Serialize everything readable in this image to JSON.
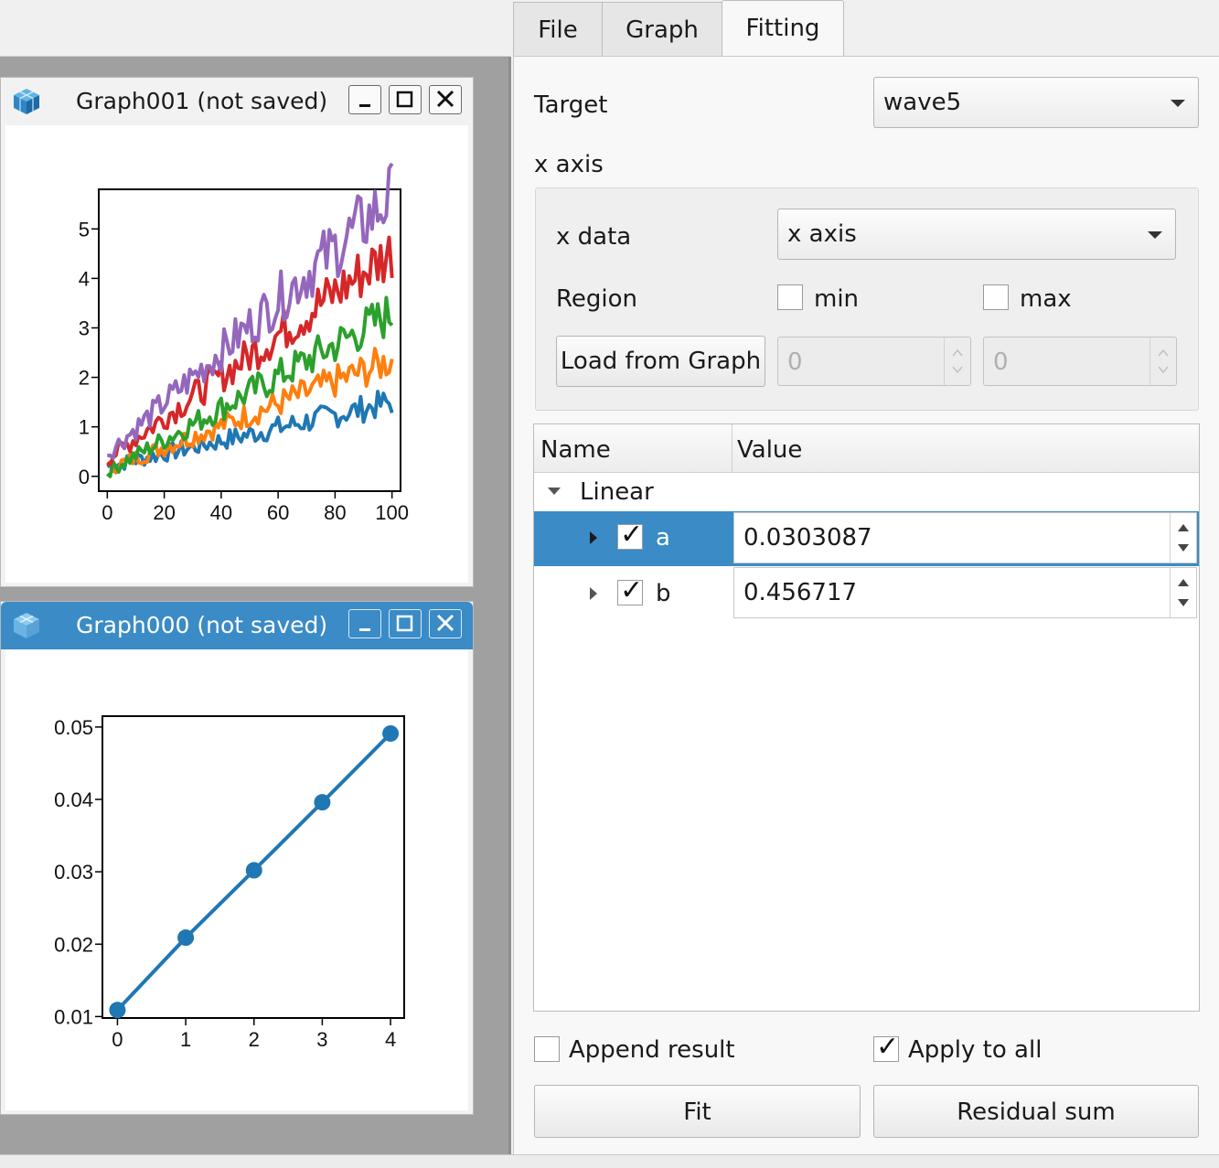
{
  "tabs": [
    {
      "label": "File"
    },
    {
      "label": "Graph"
    },
    {
      "label": "Fitting",
      "selected": true
    }
  ],
  "windows": {
    "graph001": {
      "title": "Graph001 (not saved)",
      "active": false,
      "chart_data": {
        "type": "line",
        "xlim": [
          -3,
          103
        ],
        "ylim": [
          -0.3,
          5.8
        ],
        "xticks": [
          0,
          20,
          40,
          60,
          80,
          100
        ],
        "yticks": [
          0,
          1,
          2,
          3,
          4,
          5
        ],
        "grid": false,
        "series": [
          {
            "color": "#1f77b4",
            "slope": 0.013,
            "start": 0.2
          },
          {
            "color": "#ff7f0e",
            "slope": 0.022,
            "start": 0.15
          },
          {
            "color": "#2ca02c",
            "slope": 0.032,
            "start": 0.1
          },
          {
            "color": "#d62728",
            "slope": 0.042,
            "start": 0.35
          },
          {
            "color": "#9467bd",
            "slope": 0.052,
            "start": 0.45
          }
        ]
      }
    },
    "graph000": {
      "title": "Graph000 (not saved)",
      "active": true,
      "chart_data": {
        "type": "line",
        "x": [
          0,
          1,
          2,
          3,
          4
        ],
        "y": [
          0.0109,
          0.0209,
          0.0302,
          0.0396,
          0.0491
        ],
        "xlim": [
          -0.22,
          4.2
        ],
        "ylim": [
          0.0098,
          0.0515
        ],
        "xticks": [
          "0",
          "1",
          "2",
          "3",
          "4"
        ],
        "yticks": [
          "0.01",
          "0.02",
          "0.03",
          "0.04",
          "0.05"
        ],
        "markers": true,
        "grid": false,
        "color": "#1f77b4"
      }
    }
  },
  "fitting": {
    "target_label": "Target",
    "target_value": "wave5",
    "xaxis_section": "x axis",
    "xdata_label": "x data",
    "xdata_value": "x axis",
    "region_label": "Region",
    "min_label": "min",
    "max_label": "max",
    "load_button": "Load from Graph",
    "min_value": "0",
    "max_value": "0",
    "tree": {
      "col_name": "Name",
      "col_value": "Value",
      "group": "Linear",
      "params": [
        {
          "name": "a",
          "value": "0.0303087",
          "checked": true,
          "selected": true
        },
        {
          "name": "b",
          "value": "0.456717",
          "checked": true,
          "selected": false
        }
      ]
    },
    "append_result": "Append result",
    "apply_to_all": "Apply to all",
    "fit_button": "Fit",
    "residual_button": "Residual sum"
  }
}
